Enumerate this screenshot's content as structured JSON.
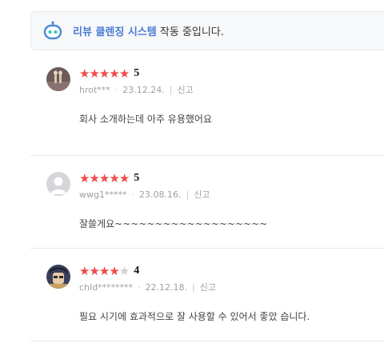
{
  "banner": {
    "accent": "리뷰 클렌징 시스템",
    "rest": " 작동 중입니다."
  },
  "colors": {
    "star_on": "#f04a4a",
    "star_off": "#cfcfcf",
    "accent": "#4a7bd6"
  },
  "reviews": [
    {
      "rating": 5,
      "score_label": "5",
      "user": "hrot***",
      "date": "23.12.24.",
      "report": "신고",
      "text": "회사 소개하는데 아주 유용했어요",
      "avatar": "photo-avatar"
    },
    {
      "rating": 5,
      "score_label": "5",
      "user": "wwg1*****",
      "date": "23.08.16.",
      "report": "신고",
      "text": "잘쓸게요~~~~~~~~~~~~~~~~~~~",
      "avatar": "default-user-avatar"
    },
    {
      "rating": 4,
      "score_label": "4",
      "user": "chld********",
      "date": "22.12.18.",
      "report": "신고",
      "text": "필요 시기에 효과적으로 잘 사용할 수 있어서 좋았 습니다.",
      "avatar": "character-avatar"
    }
  ]
}
